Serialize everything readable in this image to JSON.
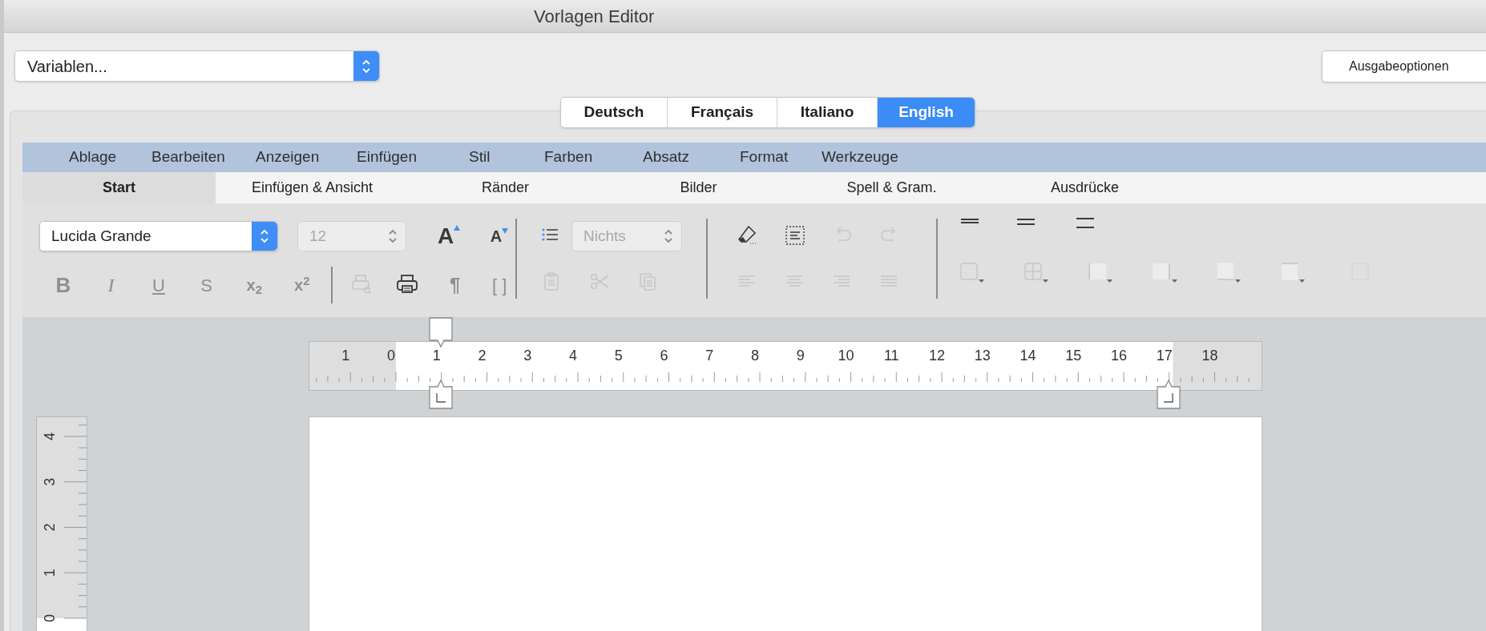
{
  "window": {
    "title": "Vorlagen Editor"
  },
  "variables_menu": {
    "value": "Variablen..."
  },
  "output_options_button": {
    "label": "Ausgabeoptionen"
  },
  "languages": [
    {
      "label": "Deutsch",
      "selected": false
    },
    {
      "label": "Français",
      "selected": false
    },
    {
      "label": "Italiano",
      "selected": false
    },
    {
      "label": "English",
      "selected": true
    }
  ],
  "menu_bar": [
    "Ablage",
    "Bearbeiten",
    "Anzeigen",
    "Einfügen",
    "Stil",
    "Farben",
    "Absatz",
    "Format",
    "Werkzeuge"
  ],
  "ribbon_tabs": [
    {
      "label": "Start",
      "selected": true
    },
    {
      "label": "Einfügen & Ansicht",
      "selected": false
    },
    {
      "label": "Ränder",
      "selected": false
    },
    {
      "label": "Bilder",
      "selected": false
    },
    {
      "label": "Spell & Gram.",
      "selected": false
    },
    {
      "label": "Ausdrücke",
      "selected": false
    }
  ],
  "font_menu": {
    "value": "Lucida Grande",
    "disabled": false
  },
  "size_menu": {
    "value": "12",
    "disabled": true
  },
  "style_menu": {
    "value": "Nichts",
    "disabled": true
  },
  "tools": {
    "grow_font": {
      "glyph": "A",
      "disabled": false
    },
    "shrink_font": {
      "glyph": "A",
      "disabled": false
    },
    "bold": {
      "glyph": "B",
      "disabled": true
    },
    "italic": {
      "glyph": "I",
      "disabled": true
    },
    "underline": {
      "glyph": "U",
      "disabled": true
    },
    "strikethrough": {
      "glyph": "S",
      "disabled": true
    },
    "subscript": {
      "glyph": "x$_{2}$",
      "disabled": true
    },
    "superscript": {
      "glyph": "x$^{2}$",
      "disabled": true
    },
    "print_preview": {
      "disabled": true
    },
    "print": {
      "disabled": false
    },
    "pilcrow": {
      "glyph": "¶",
      "disabled": true
    },
    "brackets": {
      "glyph": "[ ]",
      "disabled": true
    },
    "list": {
      "disabled": false
    },
    "clipboard": {
      "disabled": true
    },
    "cut": {
      "disabled": true
    },
    "copy": {
      "disabled": true
    },
    "eraser": {
      "disabled": false
    },
    "text_box": {
      "disabled": false
    },
    "undo": {
      "disabled": true
    },
    "redo": {
      "disabled": true
    },
    "align_left": {
      "disabled": true
    },
    "align_center": {
      "disabled": true
    },
    "align_right": {
      "disabled": true
    },
    "justify": {
      "disabled": true
    },
    "spacing_single": {
      "disabled": false
    },
    "spacing_one_half": {
      "disabled": false
    },
    "spacing_double": {
      "disabled": false
    },
    "border_box": {
      "disabled": true
    },
    "border_grid": {
      "disabled": true
    },
    "border_left": {
      "disabled": true
    },
    "border_right": {
      "disabled": true
    },
    "border_bottom": {
      "disabled": true
    },
    "border_top": {
      "disabled": true
    },
    "border_dashed": {
      "disabled": true
    }
  },
  "horizontal_ruler": {
    "labels": [
      "1",
      "0",
      "1",
      "2",
      "3",
      "4",
      "5",
      "6",
      "7",
      "8",
      "9",
      "10",
      "11",
      "12",
      "13",
      "14",
      "15",
      "16",
      "17",
      "18"
    ]
  },
  "vertical_ruler": {
    "labels": [
      "4",
      "3",
      "2",
      "1",
      "0"
    ]
  }
}
